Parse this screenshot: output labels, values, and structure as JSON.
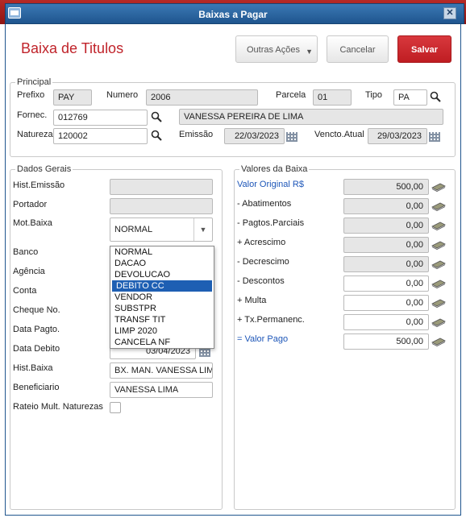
{
  "window": {
    "title": "Baixas a Pagar"
  },
  "header": {
    "title": "Baixa de Titulos",
    "other_actions": "Outras Ações",
    "cancel": "Cancelar",
    "save": "Salvar"
  },
  "principal": {
    "legend": "Principal",
    "prefixo_label": "Prefixo",
    "prefixo": "PAY",
    "numero_label": "Numero",
    "numero": "2006",
    "parcela_label": "Parcela",
    "parcela": "01",
    "tipo_label": "Tipo",
    "tipo": "PA",
    "fornec_label": "Fornec.",
    "fornec": "012769",
    "fornec_nome": "VANESSA PEREIRA DE LIMA",
    "natureza_label": "Natureza",
    "natureza": "120002",
    "emissao_label": "Emissão",
    "emissao": "22/03/2023",
    "vencto_label": "Vencto.Atual",
    "vencto": "29/03/2023"
  },
  "dados_gerais": {
    "legend": "Dados Gerais",
    "hist_emissao_label": "Hist.Emissão",
    "portador_label": "Portador",
    "mot_baixa_label": "Mot.Baixa",
    "mot_baixa": "NORMAL",
    "mot_baixa_options": [
      "NORMAL",
      "DACAO",
      "DEVOLUCAO",
      "DEBITO CC",
      "VENDOR",
      "SUBSTPR",
      "TRANSF TIT",
      "LIMP 2020",
      "CANCELA NF"
    ],
    "banco_label": "Banco",
    "agencia_label": "Agência",
    "conta_label": "Conta",
    "cheque_label": "Cheque No.",
    "data_pagto_label": "Data Pagto.",
    "data_debito_label": "Data Debito",
    "data_debito": "03/04/2023",
    "hist_baixa_label": "Hist.Baixa",
    "hist_baixa": "BX. MAN. VANESSA LIMA",
    "beneficiario_label": "Beneficiario",
    "beneficiario": "VANESSA LIMA",
    "rateio_label": "Rateio Mult. Naturezas"
  },
  "valores": {
    "legend": "Valores da Baixa",
    "rows": [
      {
        "label": "Valor Original R$",
        "value": "500,00"
      },
      {
        "label": "- Abatimentos",
        "value": "0,00"
      },
      {
        "label": "- Pagtos.Parciais",
        "value": "0,00"
      },
      {
        "label": "+ Acrescimo",
        "value": "0,00"
      },
      {
        "label": "- Decrescimo",
        "value": "0,00"
      },
      {
        "label": "- Descontos",
        "value": "0,00"
      },
      {
        "label": "+ Multa",
        "value": "0,00"
      },
      {
        "label": "+ Tx.Permanenc.",
        "value": "0,00"
      },
      {
        "label": "= Valor Pago",
        "value": "500,00"
      }
    ]
  }
}
